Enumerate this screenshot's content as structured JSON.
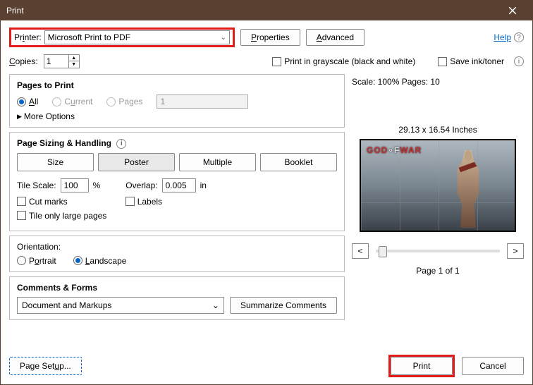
{
  "titlebar": {
    "title": "Print"
  },
  "header": {
    "printer_label": "Printer:",
    "printer_value": "Microsoft Print to PDF",
    "properties": "Properties",
    "advanced": "Advanced",
    "help": "Help"
  },
  "copies": {
    "label": "Copies:",
    "value": "1",
    "grayscale": "Print in grayscale (black and white)",
    "save_ink": "Save ink/toner"
  },
  "pages": {
    "heading": "Pages to Print",
    "all": "All",
    "current": "Current",
    "pages": "Pages",
    "pages_value": "1",
    "more": "More Options"
  },
  "sizing": {
    "heading": "Page Sizing & Handling",
    "size": "Size",
    "poster": "Poster",
    "multiple": "Multiple",
    "booklet": "Booklet",
    "tile_scale_lbl": "Tile Scale:",
    "tile_scale_val": "100",
    "tile_scale_unit": "%",
    "overlap_lbl": "Overlap:",
    "overlap_val": "0.005",
    "overlap_unit": "in",
    "cut_marks": "Cut marks",
    "labels": "Labels",
    "tile_only": "Tile only large pages"
  },
  "orientation": {
    "heading": "Orientation:",
    "portrait": "Portrait",
    "landscape": "Landscape"
  },
  "comments": {
    "heading": "Comments & Forms",
    "dd": "Document and Markups",
    "summarize": "Summarize Comments"
  },
  "preview": {
    "scale": "Scale: 100% Pages: 10",
    "dims": "29.13 x 16.54 Inches",
    "logo1": "GOD",
    "logo2": "WAR",
    "page_of": "Page 1 of 1",
    "prev": "<",
    "next": ">"
  },
  "footer": {
    "page_setup": "Page Setup...",
    "print": "Print",
    "cancel": "Cancel"
  }
}
